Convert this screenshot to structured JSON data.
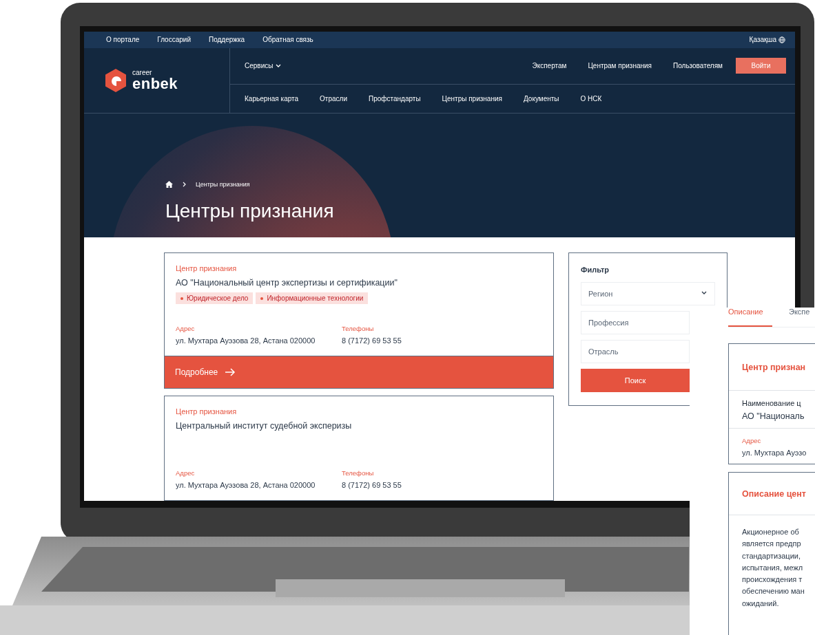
{
  "top_links": [
    "О портале",
    "Глоссарий",
    "Поддержка",
    "Обратная связь"
  ],
  "language": "Қазақша",
  "logo": {
    "small": "career",
    "big": "enbek"
  },
  "services_menu": "Сервисы",
  "header_links": [
    "Экспертам",
    "Центрам признания",
    "Пользователям"
  ],
  "login_button": "Войти",
  "nav": [
    "Карьерная карта",
    "Отрасли",
    "Профстандарты",
    "Центры признания",
    "Документы",
    "О НСК"
  ],
  "breadcrumb": "Центры признания",
  "page_title": "Центры признания",
  "cards": [
    {
      "category": "Центр признания",
      "name": "АО \"Национальный центр экспертизы и сертификации\"",
      "tags": [
        "Юридическое дело",
        "Информационные технологии"
      ],
      "address_label": "Адрес",
      "address": "ул. Мухтара Ауэзова 28, Астана 020000",
      "phones_label": "Телефоны",
      "phones": "8 (7172) 69 53 55",
      "more_button": "Подробнее"
    },
    {
      "category": "Центр признания",
      "name": "Центральный институт судебной эксперизы",
      "address_label": "Адрес",
      "address": "ул. Мухтара Ауэзова 28, Астана 020000",
      "phones_label": "Телефоны",
      "phones": "8 (7172) 69 53 55"
    }
  ],
  "filter": {
    "title": "Фильтр",
    "fields": [
      {
        "kind": "select",
        "placeholder": "Регион"
      },
      {
        "kind": "input",
        "placeholder": "Профессия"
      },
      {
        "kind": "input",
        "placeholder": "Отрасль"
      }
    ],
    "button": "Поиск"
  },
  "detail_panel": {
    "tabs": [
      {
        "label": "Описание",
        "selected": true
      },
      {
        "label": "Экспе",
        "selected": false
      }
    ],
    "section_title": "Центр признан",
    "name_label": "Наименование ц",
    "name": "АО \"Националь",
    "address_label": "Адрес",
    "address": "ул. Мухтара Ауэзо",
    "description_title": "Описание цент",
    "description_lines": [
      "Акционерное об",
      "является предпр",
      "стандартизации,",
      "испытания, межл",
      "происхождения т",
      "обеспечению ман",
      "ожиданий."
    ]
  }
}
